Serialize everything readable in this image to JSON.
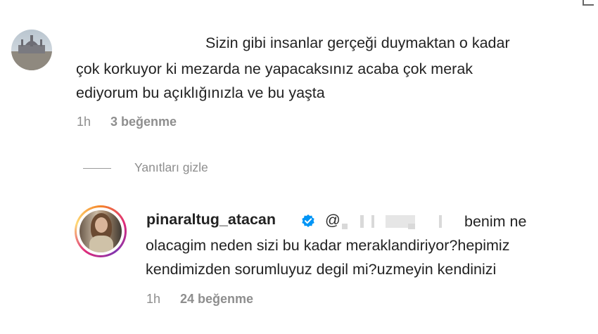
{
  "comment1": {
    "lines": [
      "Sizin gibi insanlar gerçeği duymaktan o kadar",
      "çok korkuyor ki mezarda ne yapacaksınız acaba çok merak",
      "ediyorum bu açıklığınızla ve bu yaşta"
    ],
    "time": "1h",
    "likes": "3 beğenme"
  },
  "replies_toggle": "Yanıtları gizle",
  "reply": {
    "username": "pinaraltug_atacan",
    "mention": "@",
    "line1_rest": "benim ne",
    "lines": [
      "olacagim neden sizi bu kadar meraklandiriyor?hepimiz",
      "kendimizden sorumluyuz degil mi?uzmeyin kendinizi"
    ],
    "time": "1h",
    "likes": "24 beğenme"
  },
  "icons": {
    "verified": "verified-badge-icon",
    "corner": "corner-glyph-icon"
  },
  "colors": {
    "verified_blue": "#0095f6",
    "meta_gray": "#8e8e8e"
  }
}
